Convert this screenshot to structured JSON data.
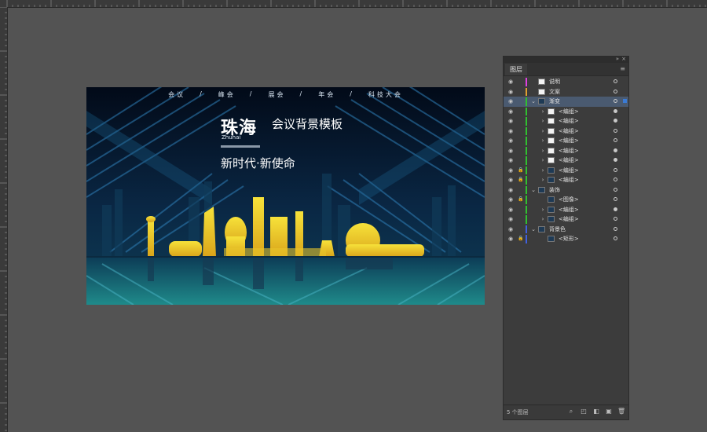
{
  "artboard": {
    "nav": [
      "会议",
      "/",
      "峰会",
      "/",
      "展会",
      "/",
      "年会",
      "/",
      "科技大会"
    ],
    "title_main": "珠海",
    "title_en": "Zhuhai",
    "title_sub": "会议背景模板",
    "slogan": "新时代·新使命"
  },
  "colors": {
    "workspace": "#535353",
    "panel_bg": "#3c3c3c",
    "selection": "#4a5a70",
    "skyline_yellow": "#f2d21c",
    "sky_dark": "#071a2e",
    "teal": "#1f8a8a"
  },
  "panel": {
    "tab_label": "图层",
    "menu_icon": "hamburger-icon",
    "footer_count": "5 个图层",
    "layers": [
      {
        "name": "说明",
        "depth": 0,
        "expand": "",
        "color": "#e040e0",
        "thumb": "white",
        "lock": false,
        "target": "hollow"
      },
      {
        "name": "文案",
        "depth": 0,
        "expand": "",
        "color": "#e0a030",
        "thumb": "white",
        "lock": false,
        "target": "hollow"
      },
      {
        "name": "渐变",
        "depth": 0,
        "expand": "v",
        "color": "#30c030",
        "thumb": "dark",
        "lock": false,
        "target": "hollow",
        "selected": true
      },
      {
        "name": "<编组>",
        "depth": 1,
        "expand": ">",
        "color": "#30c030",
        "thumb": "white",
        "lock": false,
        "target": "filled"
      },
      {
        "name": "<编组>",
        "depth": 1,
        "expand": ">",
        "color": "#30c030",
        "thumb": "white",
        "lock": false,
        "target": "filled"
      },
      {
        "name": "<编组>",
        "depth": 1,
        "expand": ">",
        "color": "#30c030",
        "thumb": "white",
        "lock": false,
        "target": "hollow"
      },
      {
        "name": "<编组>",
        "depth": 1,
        "expand": ">",
        "color": "#30c030",
        "thumb": "white",
        "lock": false,
        "target": "hollow"
      },
      {
        "name": "<编组>",
        "depth": 1,
        "expand": ">",
        "color": "#30c030",
        "thumb": "white",
        "lock": false,
        "target": "filled"
      },
      {
        "name": "<编组>",
        "depth": 1,
        "expand": ">",
        "color": "#30c030",
        "thumb": "white",
        "lock": false,
        "target": "filled"
      },
      {
        "name": "<编组>",
        "depth": 1,
        "expand": ">",
        "color": "#30c030",
        "thumb": "dark",
        "lock": true,
        "target": "hollow"
      },
      {
        "name": "<编组>",
        "depth": 1,
        "expand": ">",
        "color": "#30c030",
        "thumb": "dark",
        "lock": true,
        "target": "hollow"
      },
      {
        "name": "装饰",
        "depth": 0,
        "expand": "v",
        "color": "#30c030",
        "thumb": "dark",
        "lock": false,
        "target": "hollow"
      },
      {
        "name": "<图像>",
        "depth": 1,
        "expand": "",
        "color": "#30c030",
        "thumb": "dark",
        "lock": true,
        "target": "hollow"
      },
      {
        "name": "<编组>",
        "depth": 1,
        "expand": ">",
        "color": "#30c030",
        "thumb": "dark",
        "lock": false,
        "target": "filled"
      },
      {
        "name": "<编组>",
        "depth": 1,
        "expand": ">",
        "color": "#30c030",
        "thumb": "dark",
        "lock": false,
        "target": "hollow"
      },
      {
        "name": "背景色",
        "depth": 0,
        "expand": "v",
        "color": "#4060e0",
        "thumb": "dark",
        "lock": false,
        "target": "hollow"
      },
      {
        "name": "<矩形>",
        "depth": 1,
        "expand": "",
        "color": "#4060e0",
        "thumb": "dark",
        "lock": true,
        "target": "hollow"
      }
    ],
    "footer_icons": [
      "search-icon",
      "new-sublayer-icon",
      "clip-mask-icon",
      "new-layer-icon",
      "trash-icon"
    ]
  }
}
